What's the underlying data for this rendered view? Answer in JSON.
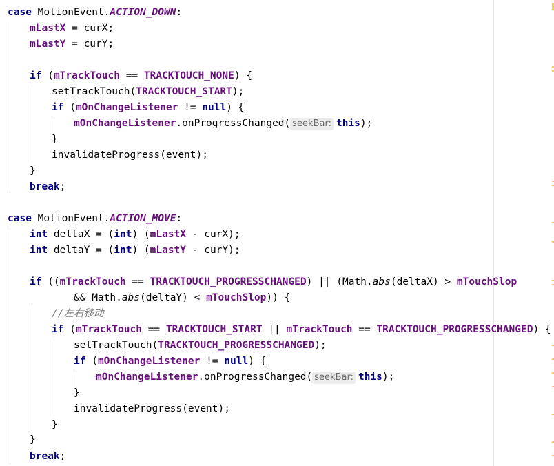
{
  "code": {
    "case_down": "case",
    "motion_event_1": " MotionEvent.",
    "action_down": "ACTION_DOWN",
    "colon_1": ":",
    "l2_field": "mLastX",
    "l2_rest": " = curX;",
    "l3_field": "mLastY",
    "l3_rest": " = curY;",
    "l5_if": "if",
    "l5_open": " (",
    "l5_field": "mTrackTouch",
    "l5_eq": " == ",
    "l5_const": "TRACKTOUCH_NONE",
    "l5_close": ") {",
    "l6_call": "setTrackTouch(",
    "l6_const": "TRACKTOUCH_START",
    "l6_end": ");",
    "l7_if": "if",
    "l7_open": " (",
    "l7_field": "mOnChangeListener",
    "l7_ne": " != ",
    "l7_null": "null",
    "l7_close": ") {",
    "l8_field": "mOnChangeListener",
    "l8_call": ".onProgressChanged(",
    "l8_hint": "seekBar:",
    "l8_this": "this",
    "l8_end": ");",
    "l9_brace": "}",
    "l10_text": "invalidateProgress(event);",
    "l11_brace": "}",
    "l12_break": "break",
    "l12_semi": ";",
    "case_move": "case",
    "motion_event_2": " MotionEvent.",
    "action_move": "ACTION_MOVE",
    "colon_2": ":",
    "l15_int": "int",
    "l15_a": " deltaX = (",
    "l15_int2": "int",
    "l15_b": ") (",
    "l15_field": "mLastX",
    "l15_c": " - curX);",
    "l16_int": "int",
    "l16_a": " deltaY = (",
    "l16_int2": "int",
    "l16_b": ") (",
    "l16_field": "mLastY",
    "l16_c": " - curY);",
    "l18_if": "if",
    "l18_a": " ((",
    "l18_field": "mTrackTouch",
    "l18_eq": " == ",
    "l18_const": "TRACKTOUCH_PROGRESSCHANGED",
    "l18_b": ") || (Math.",
    "l18_abs": "abs",
    "l18_c": "(deltaX) > ",
    "l18_field2": "mTouchSlop",
    "l19_a": "&& Math.",
    "l19_abs": "abs",
    "l19_b": "(deltaY) < ",
    "l19_field": "mTouchSlop",
    "l19_c": ")) {",
    "l20_comment": "//左右移动",
    "l21_if": "if",
    "l21_open": " (",
    "l21_field": "mTrackTouch",
    "l21_eq": " == ",
    "l21_const": "TRACKTOUCH_START",
    "l21_or": " || ",
    "l21_field2": "mTrackTouch",
    "l21_eq2": " == ",
    "l21_const2": "TRACKTOUCH_PROGRESSCHANGED",
    "l21_close": ") {",
    "l22_call": "setTrackTouch(",
    "l22_const": "TRACKTOUCH_PROGRESSCHANGED",
    "l22_end": ");",
    "l23_if": "if",
    "l23_open": " (",
    "l23_field": "mOnChangeListener",
    "l23_ne": " != ",
    "l23_null": "null",
    "l23_close": ") {",
    "l24_field": "mOnChangeListener",
    "l24_call": ".onProgressChanged(",
    "l24_hint": "seekBar:",
    "l24_this": "this",
    "l24_end": ");",
    "l25_brace": "}",
    "l26_text": "invalidateProgress(event);",
    "l27_brace": "}",
    "l28_brace": "}",
    "l29_break": "break",
    "l29_semi": ";"
  },
  "colors": {
    "keyword": "#000080",
    "field": "#660e7a",
    "comment": "#808080",
    "hint_bg": "#ececec",
    "gutter_mark": "#f2c94c"
  }
}
